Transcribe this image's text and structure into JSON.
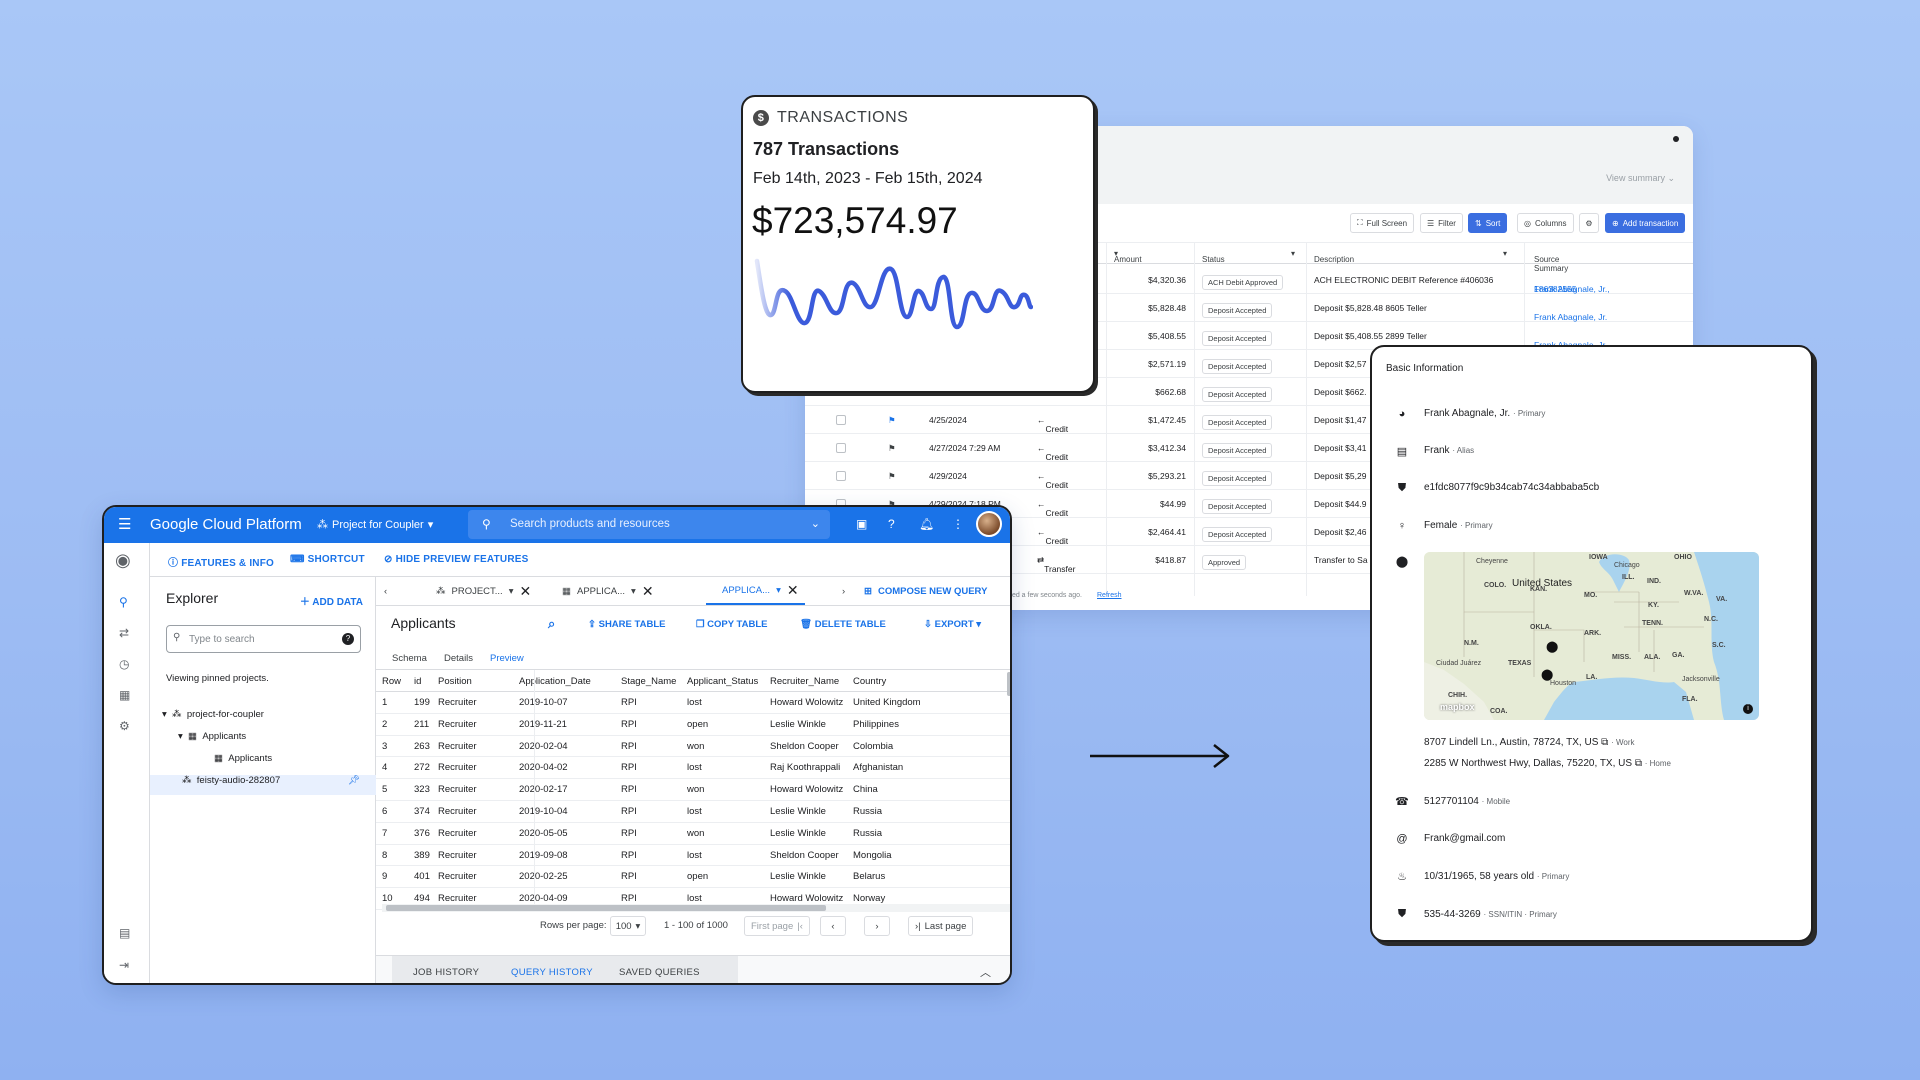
{
  "transactions_table": {
    "view_summary": "View summary",
    "buttons": {
      "full_screen": "Full Screen",
      "filter": "Filter",
      "sort": "Sort",
      "columns": "Columns",
      "add_transaction": "Add transaction"
    },
    "columns": {
      "amount": "Amount",
      "status": "Status",
      "description": "Description",
      "source_summary": "Source Summary"
    },
    "rows": [
      {
        "date": "",
        "type": "",
        "amount": "$4,320.36",
        "status": "ACH Debit Approved",
        "description": "ACH ELECTRONIC DEBIT Reference #406036",
        "source": "Frank Abagnale, Jr.,",
        "source_id": "186382555"
      },
      {
        "date": "",
        "type": "",
        "amount": "$5,828.48",
        "status": "Deposit Accepted",
        "description": "Deposit $5,828.48 8605 Teller",
        "source": "Frank Abagnale, Jr.",
        "source_id": ""
      },
      {
        "date": "",
        "type": "",
        "amount": "$5,408.55",
        "status": "Deposit Accepted",
        "description": "Deposit $5,408.55 2899 Teller",
        "source": "Frank Abagnale, Jr.",
        "source_id": ""
      },
      {
        "date": "",
        "type": "",
        "amount": "$2,571.19",
        "status": "Deposit Accepted",
        "description": "Deposit $2,57",
        "source": "",
        "source_id": ""
      },
      {
        "date": "",
        "type": "",
        "amount": "$662.68",
        "status": "Deposit Accepted",
        "description": "Deposit $662.",
        "source": "",
        "source_id": ""
      },
      {
        "date": "4/25/2024",
        "type": "Credit",
        "amount": "$1,472.45",
        "status": "Deposit Accepted",
        "description": "Deposit $1,47",
        "source": "",
        "source_id": ""
      },
      {
        "date": "4/27/2024 7:29 AM",
        "type": "Credit",
        "amount": "$3,412.34",
        "status": "Deposit Accepted",
        "description": "Deposit $3,41",
        "source": "",
        "source_id": ""
      },
      {
        "date": "4/29/2024",
        "type": "Credit",
        "amount": "$5,293.21",
        "status": "Deposit Accepted",
        "description": "Deposit $5,29",
        "source": "",
        "source_id": ""
      },
      {
        "date": "4/29/2024 7:18 PM",
        "type": "Credit",
        "amount": "$44.99",
        "status": "Deposit Accepted",
        "description": "Deposit $44.9",
        "source": "",
        "source_id": ""
      },
      {
        "date": "",
        "type": "Credit",
        "amount": "$2,464.41",
        "status": "Deposit Accepted",
        "description": "Deposit $2,46",
        "source": "",
        "source_id": ""
      },
      {
        "date": "",
        "type": "Transfer",
        "amount": "$418.87",
        "status": "Approved",
        "description": "Transfer to Sa",
        "source": "",
        "source_id": ""
      }
    ],
    "footer_text": "ted a few seconds ago.",
    "footer_link": "Refresh"
  },
  "summary_card": {
    "heading": "TRANSACTIONS",
    "count": "787 Transactions",
    "date_range": "Feb 14th, 2023 - Feb 15th, 2024",
    "total": "$723,574.97",
    "accent_color": "#3b5bdb"
  },
  "gcp": {
    "brand": "Google Cloud Platform",
    "project": "Project for Coupler",
    "search_placeholder": "Search products and resources",
    "subbar": {
      "features": "FEATURES & INFO",
      "shortcut": "SHORTCUT",
      "hide_preview": "HIDE PREVIEW FEATURES"
    },
    "explorer": {
      "title": "Explorer",
      "add_data": "ADD DATA",
      "search_placeholder": "Type to search",
      "pinned_note": "Viewing pinned projects.",
      "tree": {
        "project": "project-for-coupler",
        "dataset": "Applicants",
        "table": "Applicants",
        "project2": "feisty-audio-282807"
      }
    },
    "tabs": {
      "t1": "PROJECT...",
      "t2": "APPLICA...",
      "t3": "APPLICA...",
      "compose": "COMPOSE NEW QUERY"
    },
    "table_title": "Applicants",
    "actions": {
      "share": "SHARE TABLE",
      "copy": "COPY TABLE",
      "delete": "DELETE TABLE",
      "export": "EXPORT"
    },
    "subtabs": {
      "schema": "Schema",
      "details": "Details",
      "preview": "Preview"
    },
    "columns": [
      "Row",
      "id",
      "Position",
      "Application_Date",
      "Stage_Name",
      "Applicant_Status",
      "Recruiter_Name",
      "Country"
    ],
    "rows": [
      [
        "1",
        "199",
        "Recruiter",
        "2019-10-07",
        "RPI",
        "lost",
        "Howard Wolowitz",
        "United Kingdom"
      ],
      [
        "2",
        "211",
        "Recruiter",
        "2019-11-21",
        "RPI",
        "open",
        "Leslie Winkle",
        "Philippines"
      ],
      [
        "3",
        "263",
        "Recruiter",
        "2020-02-04",
        "RPI",
        "won",
        "Sheldon Cooper",
        "Colombia"
      ],
      [
        "4",
        "272",
        "Recruiter",
        "2020-04-02",
        "RPI",
        "lost",
        "Raj Koothrappali",
        "Afghanistan"
      ],
      [
        "5",
        "323",
        "Recruiter",
        "2020-02-17",
        "RPI",
        "won",
        "Howard Wolowitz",
        "China"
      ],
      [
        "6",
        "374",
        "Recruiter",
        "2019-10-04",
        "RPI",
        "lost",
        "Leslie Winkle",
        "Russia"
      ],
      [
        "7",
        "376",
        "Recruiter",
        "2020-05-05",
        "RPI",
        "won",
        "Leslie Winkle",
        "Russia"
      ],
      [
        "8",
        "389",
        "Recruiter",
        "2019-09-08",
        "RPI",
        "lost",
        "Sheldon Cooper",
        "Mongolia"
      ],
      [
        "9",
        "401",
        "Recruiter",
        "2020-02-25",
        "RPI",
        "open",
        "Leslie Winkle",
        "Belarus"
      ],
      [
        "10",
        "494",
        "Recruiter",
        "2020-04-09",
        "RPI",
        "lost",
        "Howard Wolowitz",
        "Norway"
      ]
    ],
    "pager": {
      "rows_per_page_label": "Rows per page:",
      "rows_per_page": "100",
      "range": "1 - 100 of 1000",
      "first_page": "First page",
      "last_page": "Last page"
    },
    "bottom_tabs": {
      "job": "JOB HISTORY",
      "query": "QUERY HISTORY",
      "saved": "SAVED QUERIES"
    }
  },
  "info_card": {
    "title": "Basic Information",
    "name": "Frank Abagnale, Jr.",
    "name_tag": "Primary",
    "alias": "Frank",
    "alias_tag": "Alias",
    "id_hash": "e1fdc8077f9c9b34cab74c34abbaba5cb",
    "gender": "Female",
    "gender_tag": "Primary",
    "address1": "8707 Lindell Ln., Austin, 78724, TX, US",
    "address1_tag": "Work",
    "address2": "2285 W Northwest Hwy, Dallas, 75220, TX, US",
    "address2_tag": "Home",
    "phone": "5127701104",
    "phone_tag": "Mobile",
    "email": "Frank@gmail.com",
    "dob": "10/31/1965, 58 years old",
    "dob_tag": "Primary",
    "ssn": "535-44-3269",
    "ssn_tag": "SSN/ITIN",
    "ssn_tag2": "Primary",
    "map": {
      "country": "United States",
      "labels": [
        "Cheyenne",
        "IOWA",
        "Chicago",
        "ILL.",
        "IND.",
        "OHIO",
        "COLO.",
        "MO.",
        "KY.",
        "W.VA.",
        "VA.",
        "KAN.",
        "OKLA.",
        "ARK.",
        "TENN.",
        "N.C.",
        "N.M.",
        "S.C.",
        "Ciudad Juárez",
        "MISS.",
        "ALA.",
        "GA.",
        "TEXAS",
        "LA.",
        "Jacksonville",
        "Houston",
        "CHIH.",
        "FLA.",
        "COA.",
        "mapbox"
      ]
    }
  }
}
